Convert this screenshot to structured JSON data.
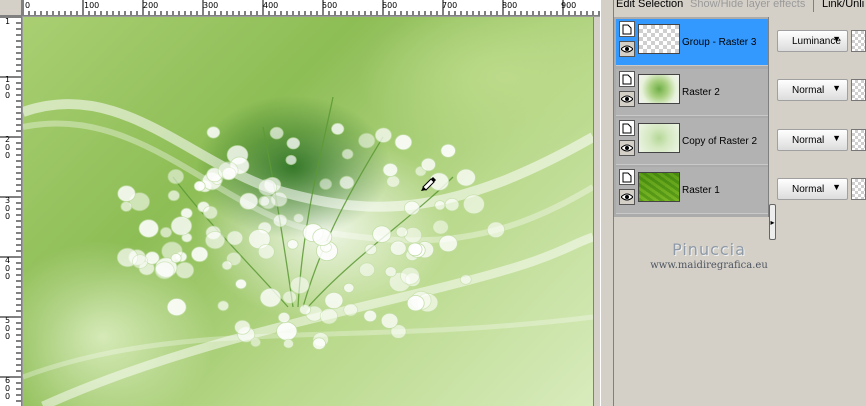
{
  "canvas": {
    "ruler_top_labels": [
      "0",
      "100",
      "200",
      "300",
      "400",
      "500",
      "600",
      "700",
      "800",
      "900"
    ],
    "ruler_left_labels": [
      "1",
      "100",
      "200",
      "300",
      "400",
      "500",
      "600"
    ]
  },
  "layers_toolbar": {
    "edit_selection": "Edit Selection",
    "show_hide": "Show/Hide layer effects",
    "link_unlink": "Link/Unli"
  },
  "layers": [
    {
      "name": "Group - Raster 3",
      "blend": "Luminance",
      "selected": true,
      "thumb": "checker"
    },
    {
      "name": "Raster 2",
      "blend": "Normal",
      "selected": false,
      "thumb": "flowers"
    },
    {
      "name": "Copy of Raster 2",
      "blend": "Normal",
      "selected": false,
      "thumb": "copyflowers"
    },
    {
      "name": "Raster 1",
      "blend": "Normal",
      "selected": false,
      "thumb": "raster1"
    }
  ],
  "watermark": {
    "name": "Pinuccia",
    "url": "www.maidiregrafica.eu"
  },
  "icons": {
    "visibility": "eye-icon",
    "layer_type": "layer-page-icon",
    "dropdown": "chevron-down-icon",
    "cursor": "brush-cursor-icon",
    "panel_handle": "chevron-right-icon"
  },
  "colors": {
    "selected_row": "#3399ff",
    "panel_bg": "#d4d0c8",
    "layer_list_bg": "#ababab"
  }
}
